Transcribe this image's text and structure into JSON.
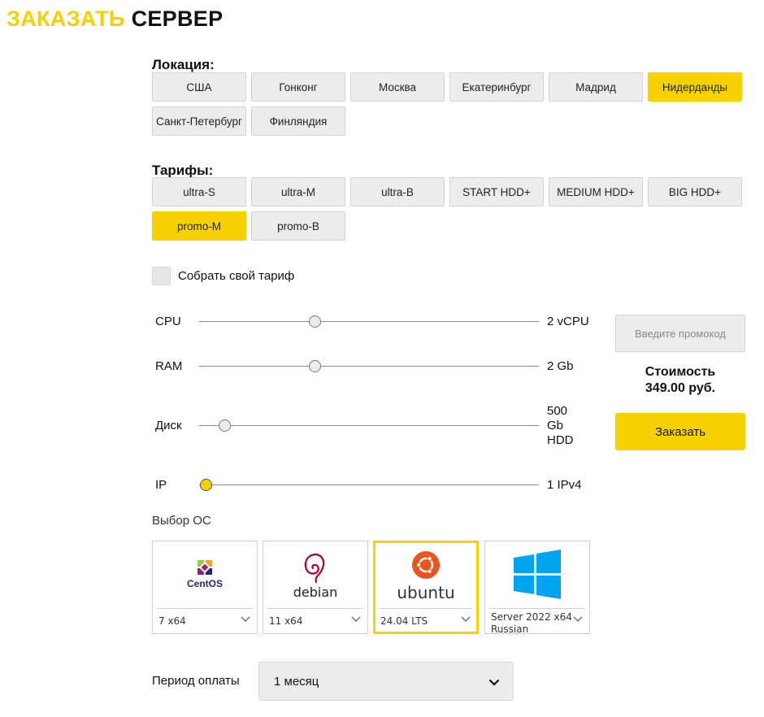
{
  "header": {
    "title_accent": "ЗАКАЗАТЬ",
    "title_rest": "СЕРВЕР"
  },
  "location": {
    "label": "Локация:",
    "options": [
      "США",
      "Гонконг",
      "Москва",
      "Екатеринбург",
      "Мадрид",
      "Нидерданды",
      "Санкт-Петербург",
      "Финляндия"
    ],
    "selected": "Нидерданды"
  },
  "tariffs": {
    "label": "Тарифы:",
    "options": [
      "ultra-S",
      "ultra-M",
      "ultra-B",
      "START HDD+",
      "MEDIUM HDD+",
      "BIG HDD+",
      "promo-M",
      "promo-B"
    ],
    "selected": "promo-M"
  },
  "custom_tariff": {
    "label": "Собрать свой тариф",
    "checked": false
  },
  "sliders": [
    {
      "name": "CPU",
      "value": "2 vCPU",
      "level": 0.34
    },
    {
      "name": "RAM",
      "value": "2 Gb",
      "level": 0.34
    },
    {
      "name": "Диск",
      "value_lines": [
        "500",
        "Gb",
        "HDD"
      ],
      "level": 0.075
    },
    {
      "name": "IP",
      "value": "1 IPv4",
      "level": 0.02
    }
  ],
  "promo": {
    "placeholder": "Введите промокод"
  },
  "cost": {
    "label": "Стоимость",
    "price": "349.00 руб."
  },
  "order_button": {
    "label": "Заказать"
  },
  "os": {
    "label": "Выбор ОС",
    "options": [
      {
        "name": "CentOS",
        "version": "7 x64"
      },
      {
        "name": "debian",
        "version": "11 x64"
      },
      {
        "name": "ubuntu",
        "version": "24.04 LTS"
      },
      {
        "name": "windows",
        "version_lines": [
          "Server 2022 x64",
          "Russian"
        ]
      }
    ],
    "selected": "ubuntu"
  },
  "period": {
    "label": "Период оплаты",
    "value": "1 месяц"
  },
  "colors": {
    "accent": "#f7d200",
    "button_bg": "#ececec",
    "ubuntu_orange": "#e95420",
    "windows_blue": "#00a4ef"
  }
}
